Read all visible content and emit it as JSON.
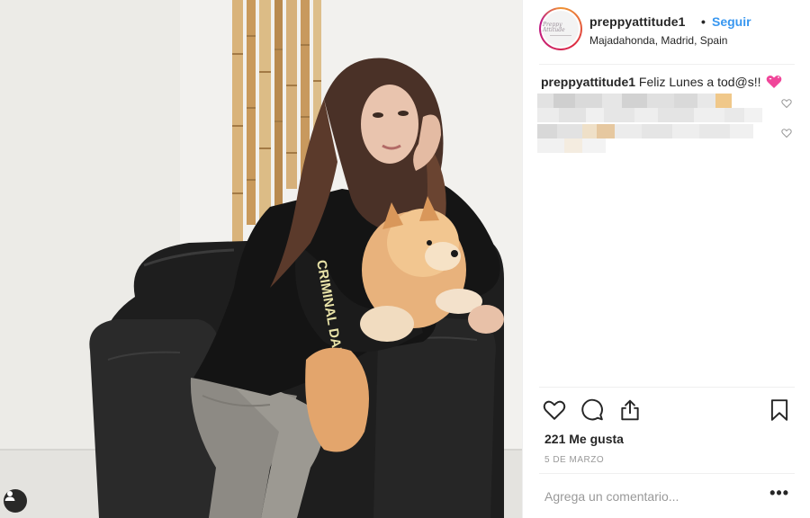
{
  "post": {
    "username": "preppyattitude1",
    "separator": "•",
    "follow_label": "Seguir",
    "location": "Majadahonda, Madrid, Spain",
    "avatar_text": "Preppy Attitude",
    "caption_text": "Feliz Lunes a tod@s!!",
    "caption_emoji": "heart-with-sparkles-icon",
    "likes_text": "221 Me gusta",
    "date_text": "5 de marzo",
    "comment_placeholder": "Agrega un comentario...",
    "more_label": "•••",
    "sweatshirt_print": "CRIMINAL DAMAGE"
  },
  "colors": {
    "link_blue": "#3897f0",
    "text": "#262626",
    "muted": "#999999",
    "divider": "#efefef"
  },
  "icons": [
    "heart-icon",
    "comment-icon",
    "share-icon",
    "bookmark-icon",
    "user-tag-icon"
  ]
}
